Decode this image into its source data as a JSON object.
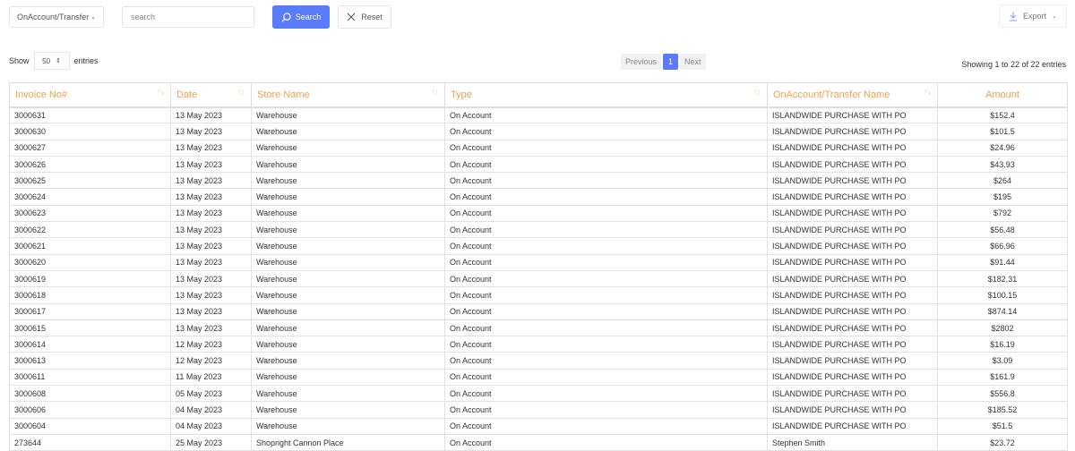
{
  "filters": {
    "type_select": "OnAccount/Transfer",
    "search_placeholder": "search",
    "search_button": "Search",
    "reset_button": "Reset",
    "export_button": "Export"
  },
  "length": {
    "show": "Show",
    "value": "50",
    "entries": "entries"
  },
  "pagination": {
    "previous": "Previous",
    "current": "1",
    "next": "Next"
  },
  "info": "Showing 1 to 22 of 22 entries",
  "colors": {
    "accent": "#5b7cfa",
    "header_text": "#f0a050"
  },
  "table": {
    "headers": [
      "Invoice No#",
      "Date",
      "Store Name",
      "Type",
      "OnAccount/Transfer Name",
      "Amount"
    ],
    "rows": [
      [
        "3000631",
        "13 May 2023",
        "Warehouse",
        "On Account",
        "ISLANDWIDE PURCHASE WITH PO",
        "$152.4"
      ],
      [
        "3000630",
        "13 May 2023",
        "Warehouse",
        "On Account",
        "ISLANDWIDE PURCHASE WITH PO",
        "$101.5"
      ],
      [
        "3000627",
        "13 May 2023",
        "Warehouse",
        "On Account",
        "ISLANDWIDE PURCHASE WITH PO",
        "$24.96"
      ],
      [
        "3000626",
        "13 May 2023",
        "Warehouse",
        "On Account",
        "ISLANDWIDE PURCHASE WITH PO",
        "$43.93"
      ],
      [
        "3000625",
        "13 May 2023",
        "Warehouse",
        "On Account",
        "ISLANDWIDE PURCHASE WITH PO",
        "$264"
      ],
      [
        "3000624",
        "13 May 2023",
        "Warehouse",
        "On Account",
        "ISLANDWIDE PURCHASE WITH PO",
        "$195"
      ],
      [
        "3000623",
        "13 May 2023",
        "Warehouse",
        "On Account",
        "ISLANDWIDE PURCHASE WITH PO",
        "$792"
      ],
      [
        "3000622",
        "13 May 2023",
        "Warehouse",
        "On Account",
        "ISLANDWIDE PURCHASE WITH PO",
        "$56.48"
      ],
      [
        "3000621",
        "13 May 2023",
        "Warehouse",
        "On Account",
        "ISLANDWIDE PURCHASE WITH PO",
        "$66.96"
      ],
      [
        "3000620",
        "13 May 2023",
        "Warehouse",
        "On Account",
        "ISLANDWIDE PURCHASE WITH PO",
        "$91.44"
      ],
      [
        "3000619",
        "13 May 2023",
        "Warehouse",
        "On Account",
        "ISLANDWIDE PURCHASE WITH PO",
        "$182.31"
      ],
      [
        "3000618",
        "13 May 2023",
        "Warehouse",
        "On Account",
        "ISLANDWIDE PURCHASE WITH PO",
        "$100.15"
      ],
      [
        "3000617",
        "13 May 2023",
        "Warehouse",
        "On Account",
        "ISLANDWIDE PURCHASE WITH PO",
        "$874.14"
      ],
      [
        "3000615",
        "13 May 2023",
        "Warehouse",
        "On Account",
        "ISLANDWIDE PURCHASE WITH PO",
        "$2802"
      ],
      [
        "3000614",
        "12 May 2023",
        "Warehouse",
        "On Account",
        "ISLANDWIDE PURCHASE WITH PO",
        "$16.19"
      ],
      [
        "3000613",
        "12 May 2023",
        "Warehouse",
        "On Account",
        "ISLANDWIDE PURCHASE WITH PO",
        "$3.09"
      ],
      [
        "3000611",
        "11 May 2023",
        "Warehouse",
        "On Account",
        "ISLANDWIDE PURCHASE WITH PO",
        "$161.9"
      ],
      [
        "3000608",
        "05 May 2023",
        "Warehouse",
        "On Account",
        "ISLANDWIDE PURCHASE WITH PO",
        "$556.8"
      ],
      [
        "3000606",
        "04 May 2023",
        "Warehouse",
        "On Account",
        "ISLANDWIDE PURCHASE WITH PO",
        "$185.52"
      ],
      [
        "3000604",
        "04 May 2023",
        "Warehouse",
        "On Account",
        "ISLANDWIDE PURCHASE WITH PO",
        "$51.5"
      ],
      [
        "273644",
        "25 May 2023",
        "Shopright Cannon Place",
        "On Account",
        "Stephen Smith",
        "$23.72"
      ]
    ]
  }
}
